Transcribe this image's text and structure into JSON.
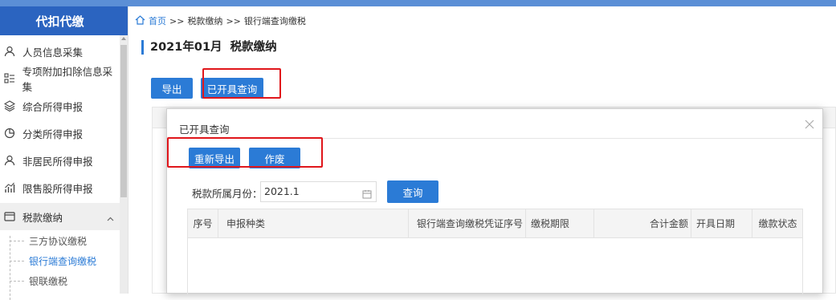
{
  "sidebar": {
    "title": "代扣代缴",
    "items": [
      {
        "label": "人员信息采集",
        "icon": "person-icon"
      },
      {
        "label": "专项附加扣除信息采集",
        "icon": "list-icon"
      },
      {
        "label": "综合所得申报",
        "icon": "layers-icon"
      },
      {
        "label": "分类所得申报",
        "icon": "pie-icon"
      },
      {
        "label": "非居民所得申报",
        "icon": "person-icon"
      },
      {
        "label": "限售股所得申报",
        "icon": "bar-chart-icon"
      },
      {
        "label": "税款缴纳",
        "icon": "folder-icon"
      }
    ],
    "subitems": [
      "三方协议缴税",
      "银行端查询缴税",
      "银联缴税"
    ]
  },
  "breadcrumb": {
    "home": "首页",
    "sep1": ">>",
    "level1": "税款缴纳",
    "sep2": ">>",
    "level2": "银行端查询缴税"
  },
  "page": {
    "title": "2021年01月  税款缴纳"
  },
  "toolbar": {
    "export_label": "导出",
    "issued_query_label": "已开具查询"
  },
  "modal": {
    "title": "已开具查询",
    "reexport_label": "重新导出",
    "void_label": "作废",
    "filter_label": "税款所属月份：",
    "month_value": "2021.1",
    "query_label": "查询",
    "columns": [
      "序号",
      "申报种类",
      "银行端查询缴税凭证序号",
      "缴税期限",
      "合计金额",
      "开具日期",
      "缴款状态"
    ]
  },
  "colors": {
    "accent": "#2b7bd6",
    "sidebar_header": "#2b64c0",
    "highlight": "#e0161b"
  }
}
